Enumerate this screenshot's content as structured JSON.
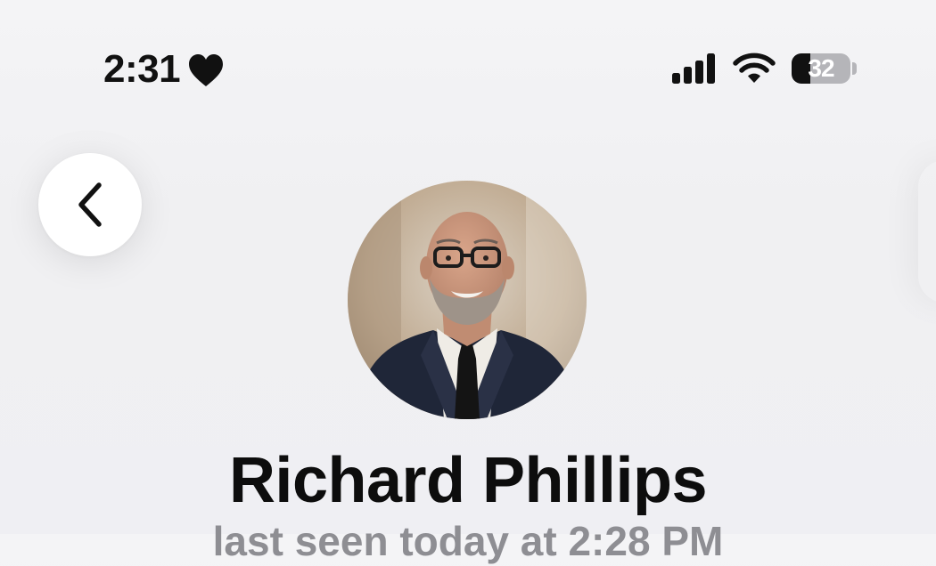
{
  "status_bar": {
    "time": "2:31",
    "battery_level": "32",
    "battery_fraction": 0.32,
    "icons": [
      "heart-icon",
      "signal-icon",
      "wifi-icon",
      "battery-icon"
    ]
  },
  "navigation": {
    "back_icon": "chevron-left-icon"
  },
  "profile": {
    "name": "Richard Phillips",
    "status": "last seen today at 2:28 PM"
  },
  "colors": {
    "background": "#efeff3",
    "text_primary": "#0d0d0d",
    "text_secondary": "#8e8e93",
    "button_background": "#ffffff"
  }
}
